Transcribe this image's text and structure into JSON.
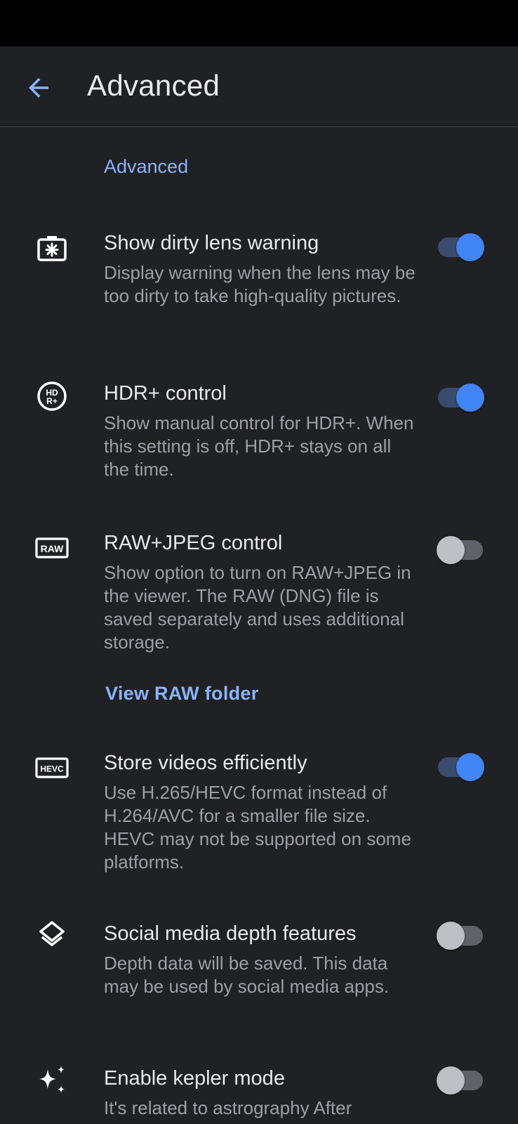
{
  "app_bar": {
    "title": "Advanced"
  },
  "section_header": "Advanced",
  "settings": [
    {
      "title": "Show dirty lens warning",
      "summary": "Display warning when the lens may be too dirty to take high-quality pictures.",
      "enabled": true,
      "icon": "dirty-lens-icon"
    },
    {
      "title": "HDR+ control",
      "summary": "Show manual control for HDR+. When this setting is off, HDR+ stays on all the time.",
      "enabled": true,
      "icon": "hdr-plus-icon"
    },
    {
      "title": "RAW+JPEG control",
      "summary": "Show option to turn on RAW+JPEG in the viewer. The RAW (DNG) file is saved separately and uses additional storage.",
      "enabled": false,
      "icon": "raw-icon"
    },
    {
      "title": "Store videos efficiently",
      "summary": "Use H.265/HEVC format instead of H.264/AVC for a smaller file size. HEVC may not be supported on some platforms.",
      "enabled": true,
      "icon": "hevc-icon"
    },
    {
      "title": "Social media depth features",
      "summary": "Depth data will be saved. This data may be used by social media apps.",
      "enabled": false,
      "icon": "layers-icon"
    },
    {
      "title": "Enable kepler mode",
      "summary": "It's related to astrography After",
      "enabled": false,
      "icon": "sparkles-icon"
    }
  ],
  "raw_folder_link": "View RAW folder",
  "colors": {
    "background": "#202124",
    "accent": "#8ab4f8",
    "switch_on": "#4285f4"
  }
}
